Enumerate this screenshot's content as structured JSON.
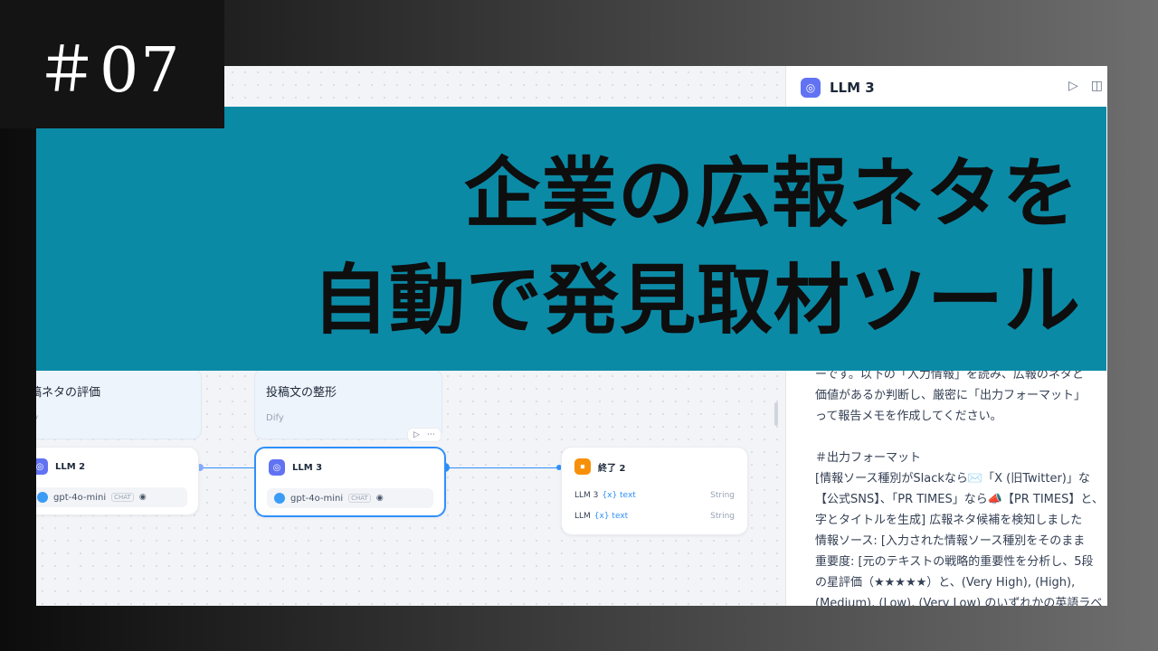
{
  "episode": "＃07",
  "banner": {
    "line1": "企業の広報ネタを",
    "line2": "自動で発見取材ツール"
  },
  "panel": {
    "title": "LLM 3",
    "icon": "brain-icon",
    "actions": [
      "play-icon",
      "layout-icon"
    ],
    "prompt_lines": [
      "ーです。以下の「入力情報」を読み、広報のネタと",
      "価値があるか判断し、厳密に「出力フォーマット」",
      "って報告メモを作成してください。",
      "",
      "＃出力フォーマット",
      "[情報ソース種別がSlackなら✉️「X (旧Twitter)」な",
      "【公式SNS】、「PR TIMES」なら📣【PR TIMES】と、",
      "字とタイトルを生成] 広報ネタ候補を検知しました",
      "情報ソース: [入力された情報ソース種別をそのまま",
      "重要度: [元のテキストの戦略的重要性を分析し、5段",
      "の星評価（★★★★★）と、(Very High), (High),",
      "(Medium), (Low), (Very Low) のいずれかの英語ラベ"
    ]
  },
  "canvas": {
    "groups": [
      {
        "title": "稿ネタの評価",
        "sub": "fy"
      },
      {
        "title": "投稿文の整形",
        "sub": "Dify"
      }
    ],
    "nodes": [
      {
        "label": "LLM 2",
        "model": "gpt-4o-mini",
        "badge": "CHAT"
      },
      {
        "label": "LLM 3",
        "model": "gpt-4o-mini",
        "badge": "CHAT"
      }
    ],
    "end_node": {
      "label": "終了 2",
      "outputs": [
        {
          "src": "LLM 3",
          "var": "{x} text",
          "type": "String"
        },
        {
          "src": "LLM",
          "var": "{x} text",
          "type": "String"
        }
      ]
    },
    "toolbar": {
      "run": "▷",
      "more": "⋯"
    }
  },
  "colors": {
    "banner": "#0b8aa6",
    "accent": "#2e90fa",
    "node_icon": "#6172f3",
    "end_icon": "#f79009"
  }
}
